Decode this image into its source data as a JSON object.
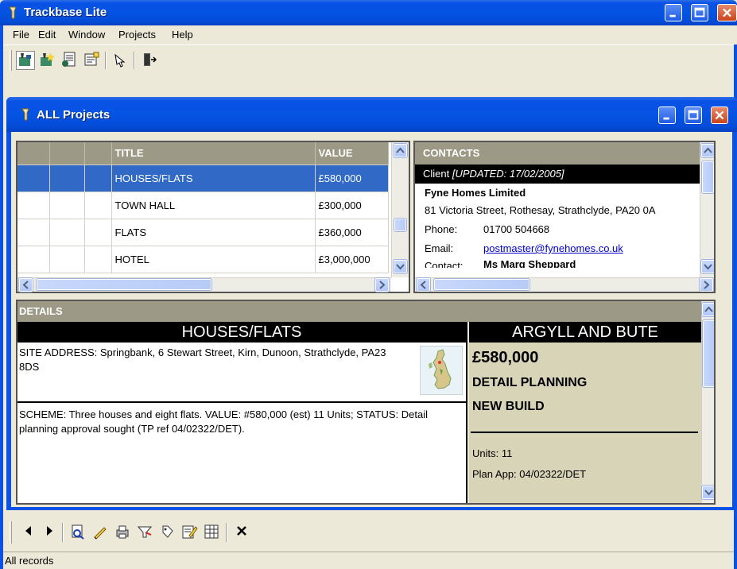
{
  "app": {
    "title": "Trackbase Lite"
  },
  "menu": [
    "File",
    "Edit",
    "Window",
    "Projects",
    "Help"
  ],
  "child": {
    "title": "ALL Projects"
  },
  "projects": {
    "columns": {
      "title": "TITLE",
      "value": "VALUE"
    },
    "rows": [
      {
        "title": "HOUSES/FLATS",
        "value": "£580,000",
        "selected": true
      },
      {
        "title": "TOWN HALL",
        "value": "£300,000",
        "selected": false
      },
      {
        "title": "FLATS",
        "value": "£360,000",
        "selected": false
      },
      {
        "title": "HOTEL",
        "value": "£3,000,000",
        "selected": false
      }
    ]
  },
  "contacts": {
    "header": "CONTACTS",
    "client_label": "Client",
    "client_updated": "[UPDATED: 17/02/2005]",
    "company": "Fyne Homes Limited",
    "address": "81 Victoria Street, Rothesay, Strathclyde, PA20 0A",
    "phone_label": "Phone:",
    "phone": "01700 504668",
    "email_label": "Email:",
    "email": "postmaster@fynehomes.co.uk",
    "contact_label": "Contact:",
    "contact": "Ms Marg Sheppard"
  },
  "details": {
    "header": "DETAILS",
    "title": "HOUSES/FLATS",
    "site_address": "SITE ADDRESS: Springbank, 6 Stewart Street, Kirn, Dunoon, Strathclyde, PA23 8DS",
    "scheme": "SCHEME: Three houses and eight flats.  VALUE: #580,000 (est)  11 Units; STATUS: Detail planning approval sought (TP ref  04/02322/DET).",
    "region": "ARGYLL AND BUTE",
    "value": "£580,000",
    "stage": "DETAIL PLANNING",
    "type": "NEW BUILD",
    "units": "Units: 11",
    "plan_app": "Plan App: 04/02322/DET"
  },
  "status": {
    "text": "All records"
  },
  "colors": {
    "titlebar": "#0a52e6",
    "selection": "#3169c6",
    "header": "#9c9a86",
    "detail_right": "#d8d4b8"
  },
  "icons": {
    "toolbar_top": [
      "open-project-icon",
      "new-project-icon",
      "report-icon",
      "contacts-icon",
      "pointer-icon",
      "exit-icon"
    ],
    "navigator": [
      "previous-icon",
      "next-icon",
      "find-icon",
      "edit-icon",
      "print-icon",
      "filter-icon",
      "tag-icon",
      "notes-icon",
      "grid-icon",
      "close-icon"
    ]
  }
}
